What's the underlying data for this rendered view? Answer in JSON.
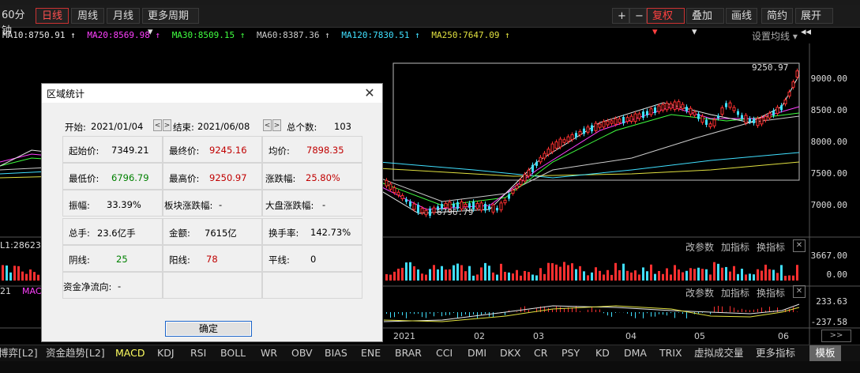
{
  "toolbar": {
    "left_items": [
      "60分钟",
      "日线",
      "周线",
      "月线",
      "更多周期 ▾"
    ],
    "active_item": "日线",
    "right_items": {
      "plus": "+",
      "minus": "−",
      "fuquan": "复权 ▾",
      "diejia": "叠加 ▾",
      "huaxian": "画线",
      "jianyue": "简约",
      "zhankai": "展开 ◂◂"
    }
  },
  "ma_line": [
    {
      "text": "MA10:8750.91 ↑",
      "color": "#e8e8e8"
    },
    {
      "text": "MA20:8569.98 ↑",
      "color": "#ff40ff"
    },
    {
      "text": "MA30:8509.15 ↑",
      "color": "#40ff40"
    },
    {
      "text": "MA60:8387.36 ↑",
      "color": "#cccccc"
    },
    {
      "text": "MA120:7830.51 ↑",
      "color": "#40e0ff"
    },
    {
      "text": "MA250:7647.09 ↑",
      "color": "#e0e040"
    }
  ],
  "settings_ma": "设置均线 ▾",
  "price_axis": [
    "9000.00",
    "8500.00",
    "8000.00",
    "7500.00",
    "7000.00"
  ],
  "chart_labels": {
    "high_label": "9250.97",
    "low_label": "6796.79"
  },
  "sub_panels": {
    "panel1": {
      "left_label": "L1:2862396",
      "buttons": [
        "改参数",
        "加指标",
        "换指标"
      ],
      "close": "✕",
      "axis": [
        "3667.00",
        "0.00"
      ]
    },
    "panel2": {
      "left_label": "21",
      "left_label2": "MACD",
      "buttons": [
        "改参数",
        "加指标",
        "换指标"
      ],
      "close": "✕",
      "axis": [
        "233.63",
        "-237.58"
      ]
    }
  },
  "time_axis": [
    "2021",
    "02",
    "03",
    "04",
    "05",
    "06"
  ],
  "bottom_tabs": [
    "博弈[L2]",
    "资金趋势[L2]",
    "MACD",
    "KDJ",
    "RSI",
    "BOLL",
    "WR",
    "OBV",
    "BIAS",
    "ENE",
    "BRAR",
    "CCI",
    "DMI",
    "DKX",
    "CR",
    "PSY",
    "KD",
    "DMA",
    "TRIX",
    "虚拟成交量",
    "更多指标",
    "模板"
  ],
  "bottom_tabs_active": "MACD",
  "dialog": {
    "title": "区域统计",
    "start_label": "开始:",
    "start_value": "2021/01/04",
    "end_label": "结束:",
    "end_value": "2021/06/08",
    "total_label": "总个数:",
    "total_value": "103",
    "rows": {
      "qishi_label": "起始价:",
      "qishi_value": "7349.21",
      "zhongzhi_label": "最终价:",
      "zhongzhi_value": "9245.16",
      "junjia_label": "均价:",
      "junjia_value": "7898.35",
      "zuidi_label": "最低价:",
      "zuidi_value": "6796.79",
      "zuigao_label": "最高价:",
      "zuigao_value": "9250.97",
      "zhangdie_label": "涨跌幅:",
      "zhangdie_value": "25.80%",
      "zhenfu_label": "振幅:",
      "zhenfu_value": "33.39%",
      "bankuai_label": "板块涨跌幅:",
      "bankuai_value": "-",
      "dapan_label": "大盘涨跌幅:",
      "dapan_value": "-",
      "zongshou_label": "总手:",
      "zongshou_value": "23.6亿手",
      "jine_label": "金额:",
      "jine_value": "7615亿",
      "huanshou_label": "换手率:",
      "huanshou_value": "142.73%",
      "yinxian_label": "阴线:",
      "yinxian_value": "25",
      "yangxian_label": "阳线:",
      "yangxian_value": "78",
      "pingxian_label": "平线:",
      "pingxian_value": "0",
      "zijin_label": "资金净流向:",
      "zijin_value": "-"
    },
    "ok_button": "确定"
  },
  "colors": {
    "up": "#ff3030",
    "down": "#40e0ff",
    "bg": "#000000",
    "accent_red": "#ff4040"
  }
}
